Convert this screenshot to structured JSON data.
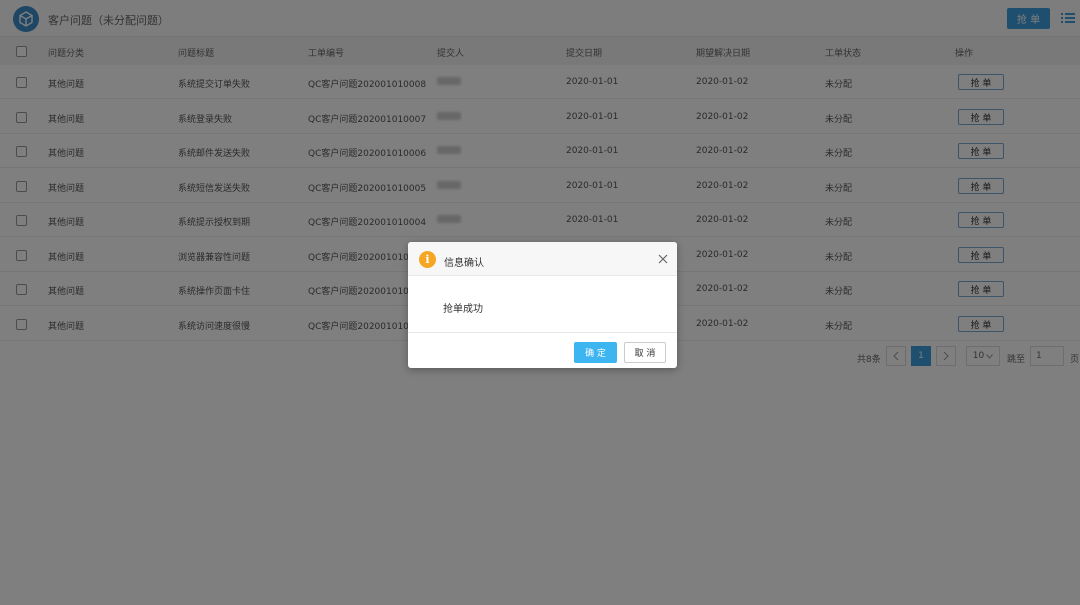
{
  "header": {
    "title": "客户问题（未分配问题）",
    "grab_label": "抢 单"
  },
  "table": {
    "columns": [
      "问题分类",
      "问题标题",
      "工单编号",
      "提交人",
      "提交日期",
      "期望解决日期",
      "工单状态",
      "操作"
    ],
    "rows": [
      {
        "category": "其他问题",
        "title": "系统提交订单失败",
        "ticket": "QC客户问题202001010008",
        "date": "2020-01-01",
        "expected": "2020-01-02",
        "status": "未分配",
        "action": "抢 单"
      },
      {
        "category": "其他问题",
        "title": "系统登录失败",
        "ticket": "QC客户问题202001010007",
        "date": "2020-01-01",
        "expected": "2020-01-02",
        "status": "未分配",
        "action": "抢 单"
      },
      {
        "category": "其他问题",
        "title": "系统邮件发送失败",
        "ticket": "QC客户问题202001010006",
        "date": "2020-01-01",
        "expected": "2020-01-02",
        "status": "未分配",
        "action": "抢 单"
      },
      {
        "category": "其他问题",
        "title": "系统短信发送失败",
        "ticket": "QC客户问题202001010005",
        "date": "2020-01-01",
        "expected": "2020-01-02",
        "status": "未分配",
        "action": "抢 单"
      },
      {
        "category": "其他问题",
        "title": "系统提示授权到期",
        "ticket": "QC客户问题202001010004",
        "date": "2020-01-01",
        "expected": "2020-01-02",
        "status": "未分配",
        "action": "抢 单"
      },
      {
        "category": "其他问题",
        "title": "浏览器兼容性问题",
        "ticket": "QC客户问题202001010",
        "date": "",
        "expected": "2020-01-02",
        "status": "未分配",
        "action": "抢 单"
      },
      {
        "category": "其他问题",
        "title": "系统操作页面卡住",
        "ticket": "QC客户问题202001010",
        "date": "",
        "expected": "2020-01-02",
        "status": "未分配",
        "action": "抢 单"
      },
      {
        "category": "其他问题",
        "title": "系统访问速度很慢",
        "ticket": "QC客户问题202001010",
        "date": "",
        "expected": "2020-01-02",
        "status": "未分配",
        "action": "抢 单"
      }
    ]
  },
  "pagination": {
    "total": "共8条",
    "current_page": "1",
    "page_size": "10",
    "jump_label": "跳至",
    "jump_value": "1",
    "page_suffix": "页"
  },
  "dialog": {
    "title": "信息确认",
    "message": "抢单成功",
    "ok_label": "确 定",
    "cancel_label": "取 消",
    "info_glyph": "i"
  },
  "colors": {
    "primary": "#3d9fdc",
    "dialog_ok": "#3db5f0",
    "info": "#f5a623",
    "overlay": "rgba(0,0,0,0.5)"
  },
  "icons": {
    "logo": "cube-logo-icon",
    "menu": "list-menu-icon",
    "close": "close-icon",
    "info": "info-icon"
  }
}
